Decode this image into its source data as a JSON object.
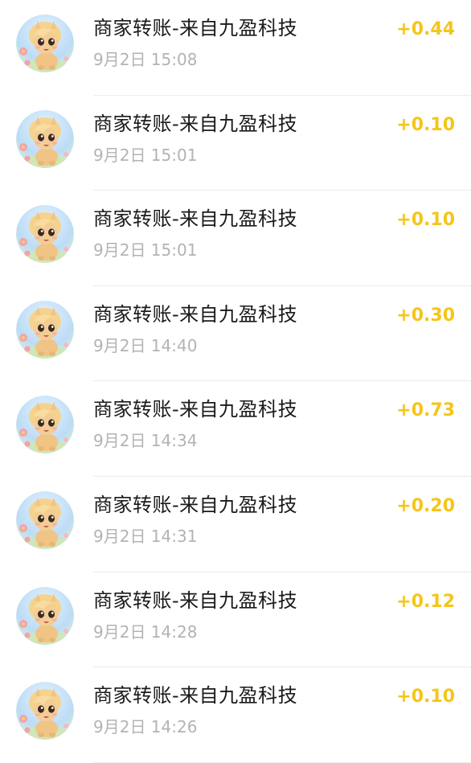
{
  "colors": {
    "amount": "#f5c518",
    "title": "#1a1a1a",
    "time": "#b3b3b3",
    "divider": "#ebebeb"
  },
  "transactions": [
    {
      "avatar_icon": "pony-avatar-icon",
      "title": "商家转账-来自九盈科技",
      "time": "9月2日 15:08",
      "amount": "+0.44"
    },
    {
      "avatar_icon": "pony-avatar-icon",
      "title": "商家转账-来自九盈科技",
      "time": "9月2日 15:01",
      "amount": "+0.10"
    },
    {
      "avatar_icon": "pony-avatar-icon",
      "title": "商家转账-来自九盈科技",
      "time": "9月2日 15:01",
      "amount": "+0.10"
    },
    {
      "avatar_icon": "pony-avatar-icon",
      "title": "商家转账-来自九盈科技",
      "time": "9月2日 14:40",
      "amount": "+0.30"
    },
    {
      "avatar_icon": "pony-avatar-icon",
      "title": "商家转账-来自九盈科技",
      "time": "9月2日 14:34",
      "amount": "+0.73"
    },
    {
      "avatar_icon": "pony-avatar-icon",
      "title": "商家转账-来自九盈科技",
      "time": "9月2日 14:31",
      "amount": "+0.20"
    },
    {
      "avatar_icon": "pony-avatar-icon",
      "title": "商家转账-来自九盈科技",
      "time": "9月2日 14:28",
      "amount": "+0.12"
    },
    {
      "avatar_icon": "pony-avatar-icon",
      "title": "商家转账-来自九盈科技",
      "time": "9月2日 14:26",
      "amount": "+0.10"
    }
  ]
}
